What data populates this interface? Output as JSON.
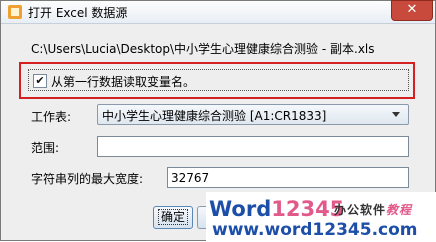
{
  "dialog": {
    "title": "打开 Excel 数据源",
    "close_glyph": "✕",
    "file_path": "C:\\Users\\Lucia\\Desktop\\中小学生心理健康综合测验 - 副本.xls",
    "first_row_checkbox": {
      "label": "从第一行数据读取变量名。",
      "checked": true,
      "mark": "✔"
    },
    "worksheet": {
      "label": "工作表:",
      "selected": "中小学生心理健康综合测验 [A1:CR1833]"
    },
    "range": {
      "label": "范围:",
      "value": ""
    },
    "max_width": {
      "label": "字符串列的最大宽度:",
      "value": "32767"
    },
    "buttons": {
      "ok": "确定",
      "cancel": ""
    }
  },
  "watermark": {
    "logo_word": "Word",
    "logo_num": "12345",
    "tagline_a": "办公软件",
    "tagline_b": "教程",
    "url": "www.word12345.com"
  },
  "colors": {
    "highlight_border": "#d42020",
    "close_button": "#c84a3c",
    "watermark_blue": "#1d4fa8",
    "watermark_pink": "#e25a8a"
  }
}
